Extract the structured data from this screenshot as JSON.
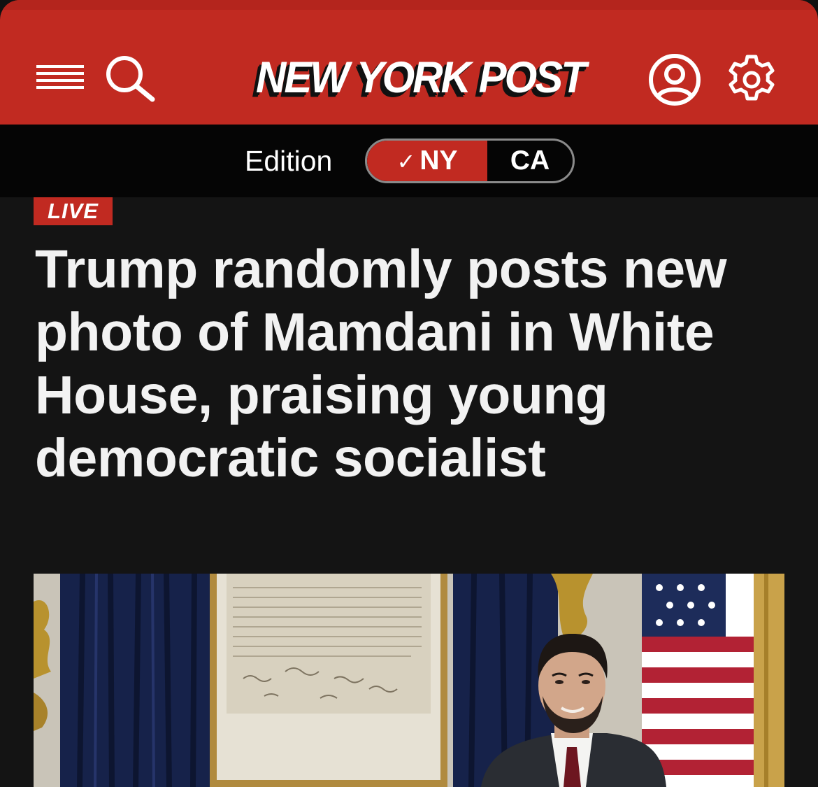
{
  "header": {
    "logo_text": "NEW YORK POST",
    "icons": [
      "menu-icon",
      "search-icon",
      "account-icon",
      "settings-icon"
    ],
    "background_color": "#c12a21"
  },
  "edition": {
    "label": "Edition",
    "options": [
      {
        "label": "NY",
        "selected": true
      },
      {
        "label": "CA",
        "selected": false
      }
    ],
    "selected_marker": "✓"
  },
  "article": {
    "badge": "LIVE",
    "headline": "Trump randomly posts new photo of Mamdani in White House, praising young democratic socialist"
  },
  "colors": {
    "accent": "#c12a21",
    "bar_background": "#050505",
    "page_background": "#141414",
    "headline_text": "#f2f2f2"
  }
}
